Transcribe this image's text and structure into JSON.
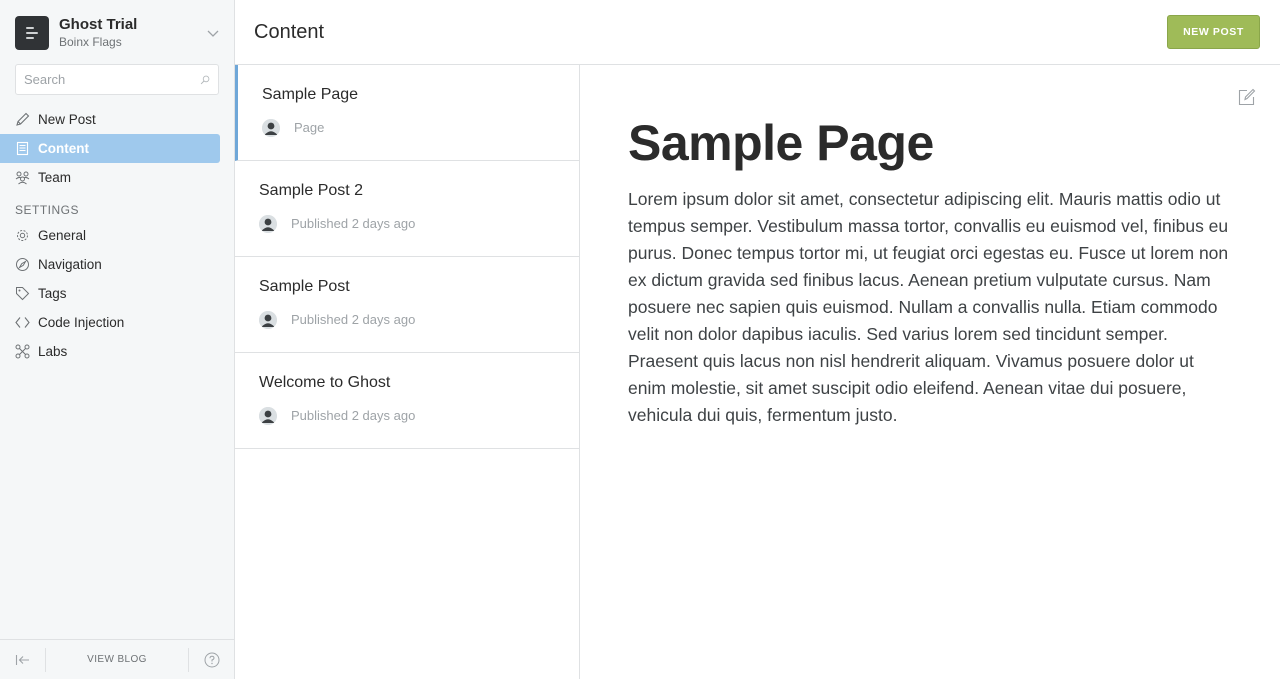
{
  "sidebar": {
    "blog_title": "Ghost Trial",
    "blog_user": "Boinx Flags",
    "search": {
      "placeholder": "Search"
    },
    "nav": [
      {
        "label": "New Post",
        "icon": "pen-icon"
      },
      {
        "label": "Content",
        "icon": "content-icon",
        "active": true
      },
      {
        "label": "Team",
        "icon": "team-icon"
      }
    ],
    "settings_heading": "SETTINGS",
    "settings": [
      {
        "label": "General",
        "icon": "gear-icon"
      },
      {
        "label": "Navigation",
        "icon": "compass-icon"
      },
      {
        "label": "Tags",
        "icon": "tag-icon"
      },
      {
        "label": "Code Injection",
        "icon": "code-icon"
      },
      {
        "label": "Labs",
        "icon": "labs-icon"
      }
    ],
    "footer": {
      "view_blog": "VIEW BLOG"
    }
  },
  "header": {
    "title": "Content",
    "new_post_label": "NEW POST",
    "accent_color": "#9fbb58"
  },
  "content_list": [
    {
      "title": "Sample Page",
      "status": "Page",
      "selected": true
    },
    {
      "title": "Sample Post 2",
      "status": "Published 2 days ago"
    },
    {
      "title": "Sample Post",
      "status": "Published 2 days ago"
    },
    {
      "title": "Welcome to Ghost",
      "status": "Published 2 days ago"
    }
  ],
  "preview": {
    "title": "Sample Page",
    "body": "Lorem ipsum dolor sit amet, consectetur adipiscing elit. Mauris mattis odio ut tempus semper. Vestibulum massa tortor, convallis eu euismod vel, finibus eu purus. Donec tempus tortor mi, ut feugiat orci egestas eu. Fusce ut lorem non ex dictum gravida sed finibus lacus. Aenean pretium vulputate cursus. Nam posuere nec sapien quis euismod. Nullam a convallis nulla. Etiam commodo velit non dolor dapibus iaculis. Sed varius lorem sed tincidunt semper. Praesent quis lacus non nisl hendrerit aliquam. Vivamus posuere dolor ut enim molestie, sit amet suscipit odio eleifend. Aenean vitae dui posuere, vehicula dui quis, fermentum justo."
  }
}
